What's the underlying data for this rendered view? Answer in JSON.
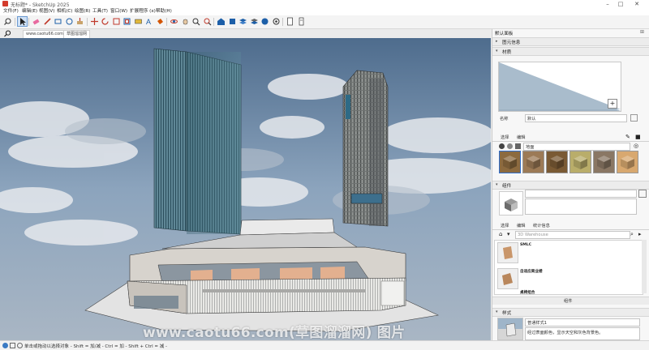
{
  "window": {
    "title": "无标题* - SketchUp 2025"
  },
  "menus": [
    "文件(F)",
    "编辑(E)",
    "视图(V)",
    "相机(C)",
    "绘图(R)",
    "工具(T)",
    "窗口(W)",
    "扩展程序 (x)",
    "帮助(H)"
  ],
  "toolbar": {
    "icons": [
      "search-icon",
      "select-arrow-icon",
      "eraser-icon",
      "pencil-icon",
      "rectangle-icon",
      "circle-icon",
      "push-pull-icon",
      "move-icon",
      "rotate-icon",
      "scale-icon",
      "offset-icon",
      "tape-measure-icon",
      "text-icon",
      "paint-bucket-icon",
      "orbit-icon",
      "pan-icon",
      "zoom-icon",
      "zoom-extents-icon",
      "warehouse-icon",
      "extension-icon",
      "layers-icon",
      "section-icon",
      "styles-icon",
      "shadows-icon",
      "document-icon",
      "info-icon"
    ]
  },
  "tabs": {
    "items": [
      "www.caotu66.com",
      "草图溜溜网"
    ]
  },
  "tray": {
    "title": "默认面板",
    "entity_info": "图元信息",
    "materials": {
      "header": "材质",
      "name_label": "名称",
      "name_value": "默认",
      "tab_select": "选择",
      "tab_edit": "编辑",
      "dropdown_value": "地面",
      "swatch_colors": [
        "#8c6a3f",
        "#9c7a56",
        "#7a5a34",
        "#b9ad6a",
        "#8a7764",
        "#d8a86f"
      ]
    },
    "components": {
      "header": "组件",
      "tab_select": "选择",
      "tab_edit": "编辑",
      "tab_stats": "统计信息",
      "search_placeholder": "3D Warehouse",
      "items": [
        {
          "name": "SMLC",
          "desc": ""
        },
        {
          "name": "自适应商业楼",
          "desc": ""
        },
        {
          "name": "桌椅组合",
          "desc": ""
        }
      ],
      "footer": "组件"
    },
    "styles": {
      "header": "样式",
      "name_value": "普通样式1",
      "desc": "经过表面颜色，显示天空和灰色背景色。"
    }
  },
  "status": {
    "text": "单击或拖动以选择对象 - Shift = 加/减 - Ctrl = 加 - Shift + Ctrl = 减 -"
  },
  "watermark": {
    "text": "www.caotu66.com(草图溜溜网) 图片"
  }
}
